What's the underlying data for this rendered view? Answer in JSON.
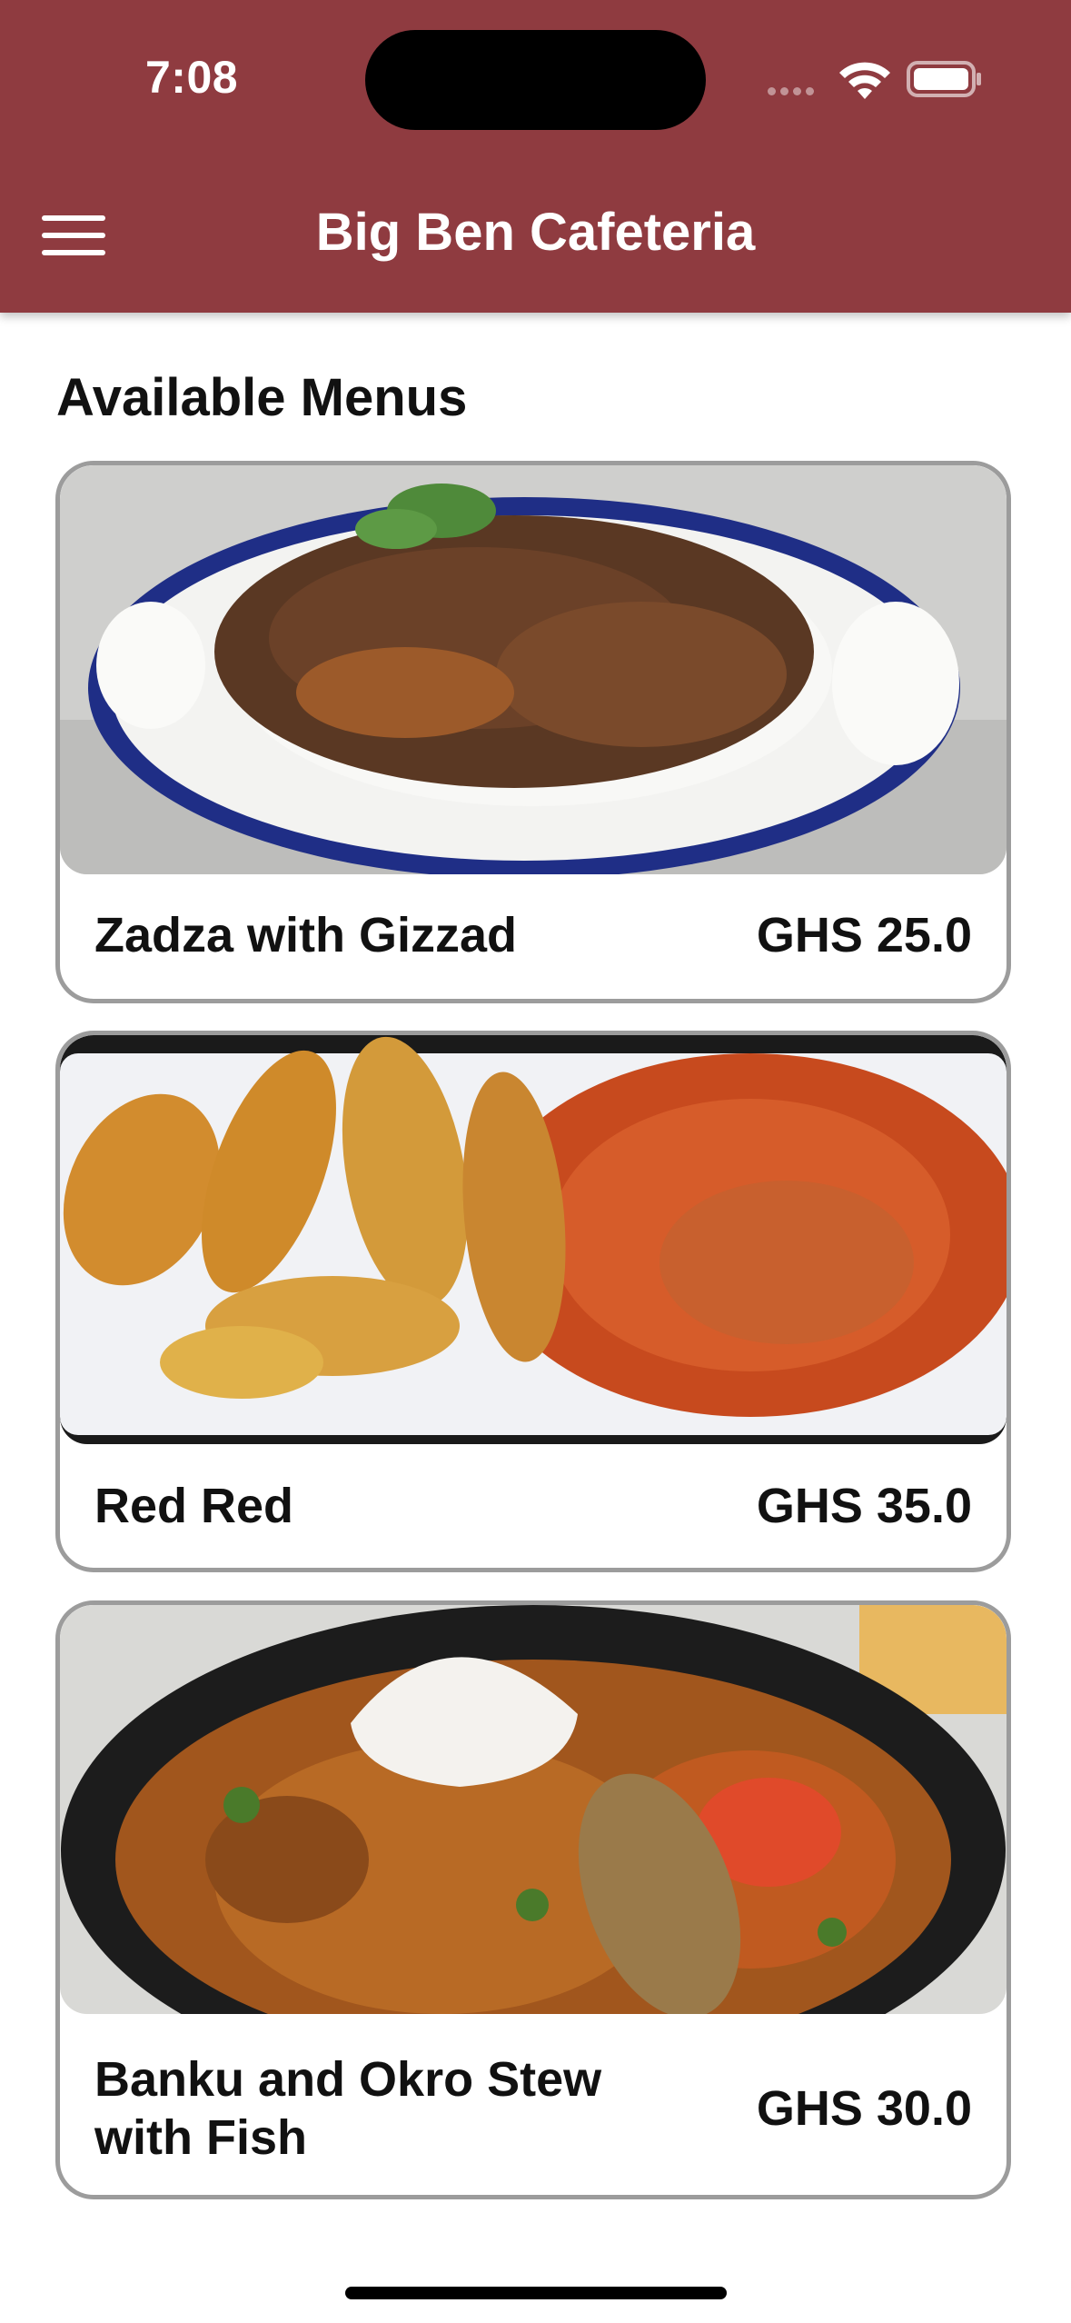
{
  "status_bar": {
    "time": "7:08"
  },
  "appbar": {
    "title": "Big Ben Cafeteria",
    "menu_icon": "hamburger-menu-icon"
  },
  "section": {
    "title": "Available Menus"
  },
  "menus": [
    {
      "name": "Zadza with Gizzad",
      "price": "GHS 25.0",
      "image": "zadza-dish-photo"
    },
    {
      "name": "Red Red",
      "price": "GHS 35.0",
      "image": "red-red-dish-photo"
    },
    {
      "name": "Banku and Okro Stew with Fish",
      "price": "GHS 30.0",
      "image": "banku-okro-dish-photo"
    }
  ],
  "colors": {
    "appbar": "#8f3b40",
    "card_border": "#9c9c9c"
  }
}
